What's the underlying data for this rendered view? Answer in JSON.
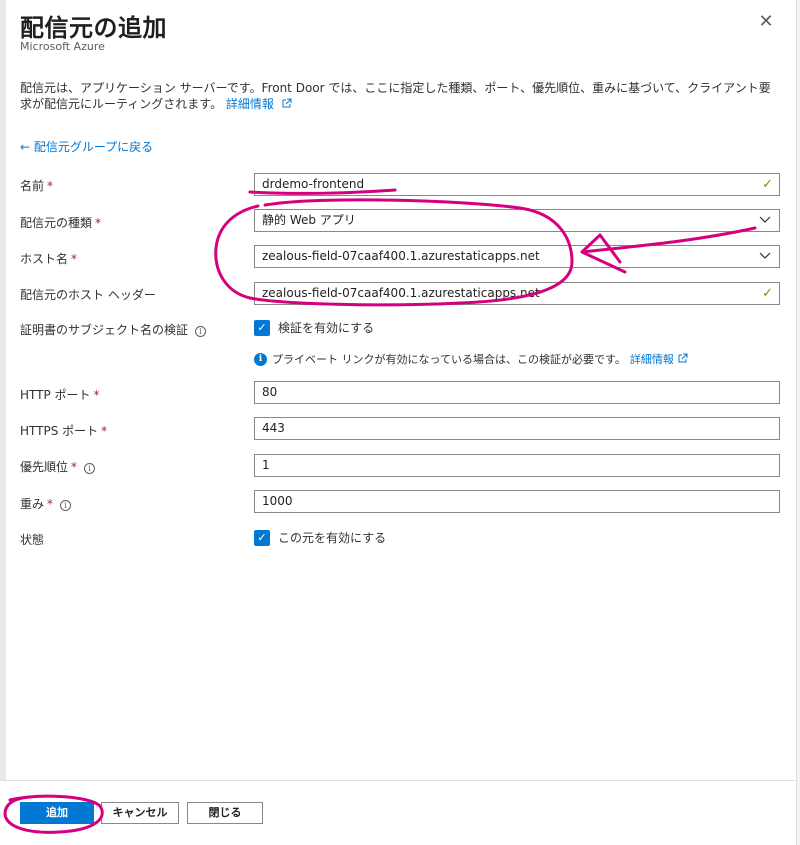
{
  "header": {
    "title": "配信元の追加",
    "subtitle": "Microsoft Azure",
    "close_glyph": "✕"
  },
  "description": {
    "text": "配信元は、アプリケーション サーバーです。Front Door では、ここに指定した種類、ポート、優先順位、重みに基づいて、クライアント要求が配信元にルーティングされます。",
    "link": "詳細情報"
  },
  "back_link": "← 配信元グループに戻る",
  "form": {
    "name": {
      "label": "名前",
      "value": "drdemo-frontend"
    },
    "origin_type": {
      "label": "配信元の種類",
      "value": "静的 Web アプリ"
    },
    "host_name": {
      "label": "ホスト名",
      "value": "zealous-field-07caaf400.1.azurestaticapps.net"
    },
    "origin_host_header": {
      "label": "配信元のホスト ヘッダー",
      "value": "zealous-field-07caaf400.1.azurestaticapps.net"
    },
    "cert_check": {
      "label": "証明書のサブジェクト名の検証",
      "checkbox_label": "検証を有効にする",
      "checked": true
    },
    "note": {
      "text": "プライベート リンクが有効になっている場合は、この検証が必要です。",
      "link": "詳細情報"
    },
    "http_port": {
      "label": "HTTP ポート",
      "value": "80"
    },
    "https_port": {
      "label": "HTTPS ポート",
      "value": "443"
    },
    "priority": {
      "label": "優先順位",
      "value": "1"
    },
    "weight": {
      "label": "重み",
      "value": "1000"
    },
    "status": {
      "label": "状態",
      "checkbox_label": "この元を有効にする",
      "checked": true
    }
  },
  "footer": {
    "add": "追加",
    "cancel": "キャンセル",
    "close": "閉じる"
  },
  "colors": {
    "accent": "#0078d4",
    "required": "#a4262c",
    "valid_check": "#57a300",
    "annotation": "#d6007f"
  },
  "icons": {
    "valid": "check-icon",
    "dropdown": "chevron-down-icon",
    "info": "info-icon",
    "external": "external-link-icon"
  }
}
